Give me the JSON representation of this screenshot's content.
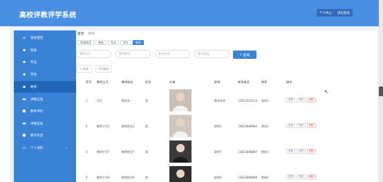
{
  "app": {
    "title": "高校评教评学系统"
  },
  "top_actions": {
    "personal": "个人中心",
    "logout": "退出登录"
  },
  "sidebar": {
    "items": [
      {
        "label": "系统首页",
        "icon": "home-icon",
        "glyph": "⌂"
      },
      {
        "label": "院系",
        "icon": "grid-icon",
        "glyph": "▪"
      },
      {
        "label": "专业",
        "icon": "grid-icon",
        "glyph": "▪"
      },
      {
        "label": "学生",
        "icon": "grid-icon",
        "glyph": "▪"
      },
      {
        "label": "教师",
        "icon": "grid-icon",
        "glyph": "▪"
      },
      {
        "label": "评教信息",
        "icon": "folder-icon",
        "glyph": "▬"
      },
      {
        "label": "教师评价",
        "icon": "cog-icon",
        "glyph": "●"
      },
      {
        "label": "评教信息",
        "icon": "folder-icon",
        "glyph": "▬"
      },
      {
        "label": "教学反思",
        "icon": "pin-icon",
        "glyph": "●"
      },
      {
        "label": "个人资料",
        "icon": "profile-icon",
        "glyph": "▭"
      }
    ],
    "active_index": 4
  },
  "breadcrumb": {
    "home": "首页",
    "current": "教师"
  },
  "tabs": [
    "系统首页",
    "院系",
    "专业",
    "学生",
    "教师"
  ],
  "search": {
    "teacher_no_placeholder": "教师工号",
    "teacher_name_placeholder": "教师姓名",
    "title_placeholder": "职称名称",
    "phone_placeholder": "联系电话",
    "button": "查询"
  },
  "buttons": {
    "add": "新增",
    "delete": "删除"
  },
  "table": {
    "headers": [
      "序号",
      "教师工号",
      "教师姓名",
      "性别",
      "头像",
      "职称",
      "联系电话",
      "院系",
      "操作"
    ],
    "rows": [
      {
        "index": "1",
        "no": "222",
        "name": "靳花朵",
        "gender": "男",
        "title": "数学老师",
        "phone": "13612514514",
        "dept": "院系3"
      },
      {
        "index": "2",
        "no": "教师工号2",
        "name": "教师姓名2",
        "gender": "男",
        "title": "职称2",
        "phone": "13823888882",
        "dept": "院系2"
      },
      {
        "index": "3",
        "no": "教师工号7",
        "name": "教师姓名7",
        "gender": "男",
        "title": "职称7",
        "phone": "13823888887",
        "dept": "院系7"
      },
      {
        "index": "4",
        "no": "教师工号6",
        "name": "教师姓名6",
        "gender": "男",
        "title": "职称6",
        "phone": "13823888886",
        "dept": "院系6"
      }
    ],
    "row_actions": {
      "view": "查看",
      "edit": "修改",
      "delete": "删除"
    }
  }
}
